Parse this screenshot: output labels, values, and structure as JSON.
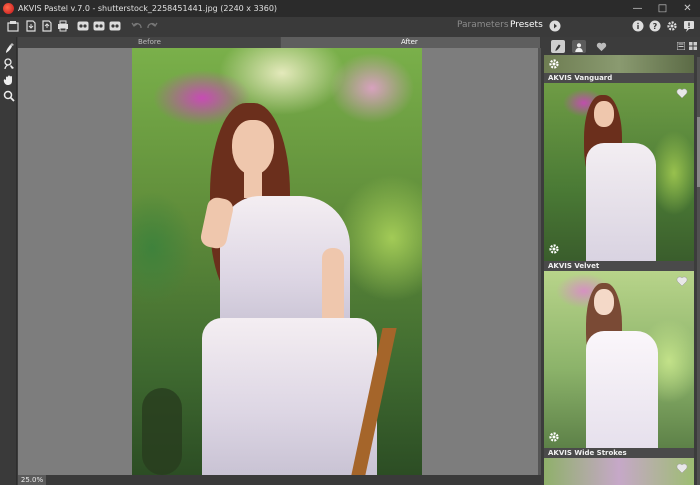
{
  "window": {
    "title": "AKVIS Pastel v.7.0 - shutterstock_2258451441.jpg (2240 x 3360)"
  },
  "toolbar": {
    "parameters_label": "Parameters",
    "presets_label": "Presets"
  },
  "view_tabs": {
    "before_label": "Before",
    "after_label": "After"
  },
  "status": {
    "zoom": "25.0%"
  },
  "presets": [
    {
      "name": "AKVIS Vanguard"
    },
    {
      "name": "AKVIS Velvet"
    },
    {
      "name": "AKVIS Wide Strokes"
    }
  ],
  "icons": {
    "toolbar_left": [
      "open-icon",
      "save-icon",
      "save-as-icon",
      "print-icon",
      "share-icon",
      "share2-icon",
      "share3-icon",
      "undo-icon",
      "redo-icon"
    ],
    "toolbar_right": [
      "run-icon",
      "info-icon",
      "help-icon",
      "settings-icon",
      "notifications-icon"
    ],
    "left_tools": [
      "pastel-brush-icon",
      "portrait-tool-icon",
      "hand-icon",
      "zoom-icon"
    ]
  },
  "colors": {
    "accent": "#c3121a",
    "panel": "#3c3c3c",
    "canvas_bg": "#7d7d7d"
  }
}
